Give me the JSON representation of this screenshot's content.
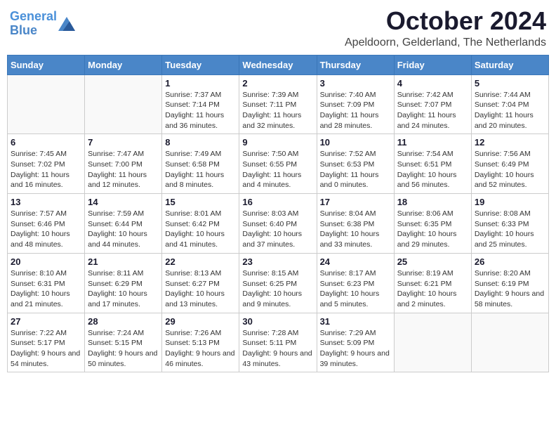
{
  "header": {
    "logo_line1": "General",
    "logo_line2": "Blue",
    "month": "October 2024",
    "location": "Apeldoorn, Gelderland, The Netherlands"
  },
  "weekdays": [
    "Sunday",
    "Monday",
    "Tuesday",
    "Wednesday",
    "Thursday",
    "Friday",
    "Saturday"
  ],
  "weeks": [
    [
      {
        "day": "",
        "info": ""
      },
      {
        "day": "",
        "info": ""
      },
      {
        "day": "1",
        "info": "Sunrise: 7:37 AM\nSunset: 7:14 PM\nDaylight: 11 hours and 36 minutes."
      },
      {
        "day": "2",
        "info": "Sunrise: 7:39 AM\nSunset: 7:11 PM\nDaylight: 11 hours and 32 minutes."
      },
      {
        "day": "3",
        "info": "Sunrise: 7:40 AM\nSunset: 7:09 PM\nDaylight: 11 hours and 28 minutes."
      },
      {
        "day": "4",
        "info": "Sunrise: 7:42 AM\nSunset: 7:07 PM\nDaylight: 11 hours and 24 minutes."
      },
      {
        "day": "5",
        "info": "Sunrise: 7:44 AM\nSunset: 7:04 PM\nDaylight: 11 hours and 20 minutes."
      }
    ],
    [
      {
        "day": "6",
        "info": "Sunrise: 7:45 AM\nSunset: 7:02 PM\nDaylight: 11 hours and 16 minutes."
      },
      {
        "day": "7",
        "info": "Sunrise: 7:47 AM\nSunset: 7:00 PM\nDaylight: 11 hours and 12 minutes."
      },
      {
        "day": "8",
        "info": "Sunrise: 7:49 AM\nSunset: 6:58 PM\nDaylight: 11 hours and 8 minutes."
      },
      {
        "day": "9",
        "info": "Sunrise: 7:50 AM\nSunset: 6:55 PM\nDaylight: 11 hours and 4 minutes."
      },
      {
        "day": "10",
        "info": "Sunrise: 7:52 AM\nSunset: 6:53 PM\nDaylight: 11 hours and 0 minutes."
      },
      {
        "day": "11",
        "info": "Sunrise: 7:54 AM\nSunset: 6:51 PM\nDaylight: 10 hours and 56 minutes."
      },
      {
        "day": "12",
        "info": "Sunrise: 7:56 AM\nSunset: 6:49 PM\nDaylight: 10 hours and 52 minutes."
      }
    ],
    [
      {
        "day": "13",
        "info": "Sunrise: 7:57 AM\nSunset: 6:46 PM\nDaylight: 10 hours and 48 minutes."
      },
      {
        "day": "14",
        "info": "Sunrise: 7:59 AM\nSunset: 6:44 PM\nDaylight: 10 hours and 44 minutes."
      },
      {
        "day": "15",
        "info": "Sunrise: 8:01 AM\nSunset: 6:42 PM\nDaylight: 10 hours and 41 minutes."
      },
      {
        "day": "16",
        "info": "Sunrise: 8:03 AM\nSunset: 6:40 PM\nDaylight: 10 hours and 37 minutes."
      },
      {
        "day": "17",
        "info": "Sunrise: 8:04 AM\nSunset: 6:38 PM\nDaylight: 10 hours and 33 minutes."
      },
      {
        "day": "18",
        "info": "Sunrise: 8:06 AM\nSunset: 6:35 PM\nDaylight: 10 hours and 29 minutes."
      },
      {
        "day": "19",
        "info": "Sunrise: 8:08 AM\nSunset: 6:33 PM\nDaylight: 10 hours and 25 minutes."
      }
    ],
    [
      {
        "day": "20",
        "info": "Sunrise: 8:10 AM\nSunset: 6:31 PM\nDaylight: 10 hours and 21 minutes."
      },
      {
        "day": "21",
        "info": "Sunrise: 8:11 AM\nSunset: 6:29 PM\nDaylight: 10 hours and 17 minutes."
      },
      {
        "day": "22",
        "info": "Sunrise: 8:13 AM\nSunset: 6:27 PM\nDaylight: 10 hours and 13 minutes."
      },
      {
        "day": "23",
        "info": "Sunrise: 8:15 AM\nSunset: 6:25 PM\nDaylight: 10 hours and 9 minutes."
      },
      {
        "day": "24",
        "info": "Sunrise: 8:17 AM\nSunset: 6:23 PM\nDaylight: 10 hours and 5 minutes."
      },
      {
        "day": "25",
        "info": "Sunrise: 8:19 AM\nSunset: 6:21 PM\nDaylight: 10 hours and 2 minutes."
      },
      {
        "day": "26",
        "info": "Sunrise: 8:20 AM\nSunset: 6:19 PM\nDaylight: 9 hours and 58 minutes."
      }
    ],
    [
      {
        "day": "27",
        "info": "Sunrise: 7:22 AM\nSunset: 5:17 PM\nDaylight: 9 hours and 54 minutes."
      },
      {
        "day": "28",
        "info": "Sunrise: 7:24 AM\nSunset: 5:15 PM\nDaylight: 9 hours and 50 minutes."
      },
      {
        "day": "29",
        "info": "Sunrise: 7:26 AM\nSunset: 5:13 PM\nDaylight: 9 hours and 46 minutes."
      },
      {
        "day": "30",
        "info": "Sunrise: 7:28 AM\nSunset: 5:11 PM\nDaylight: 9 hours and 43 minutes."
      },
      {
        "day": "31",
        "info": "Sunrise: 7:29 AM\nSunset: 5:09 PM\nDaylight: 9 hours and 39 minutes."
      },
      {
        "day": "",
        "info": ""
      },
      {
        "day": "",
        "info": ""
      }
    ]
  ]
}
